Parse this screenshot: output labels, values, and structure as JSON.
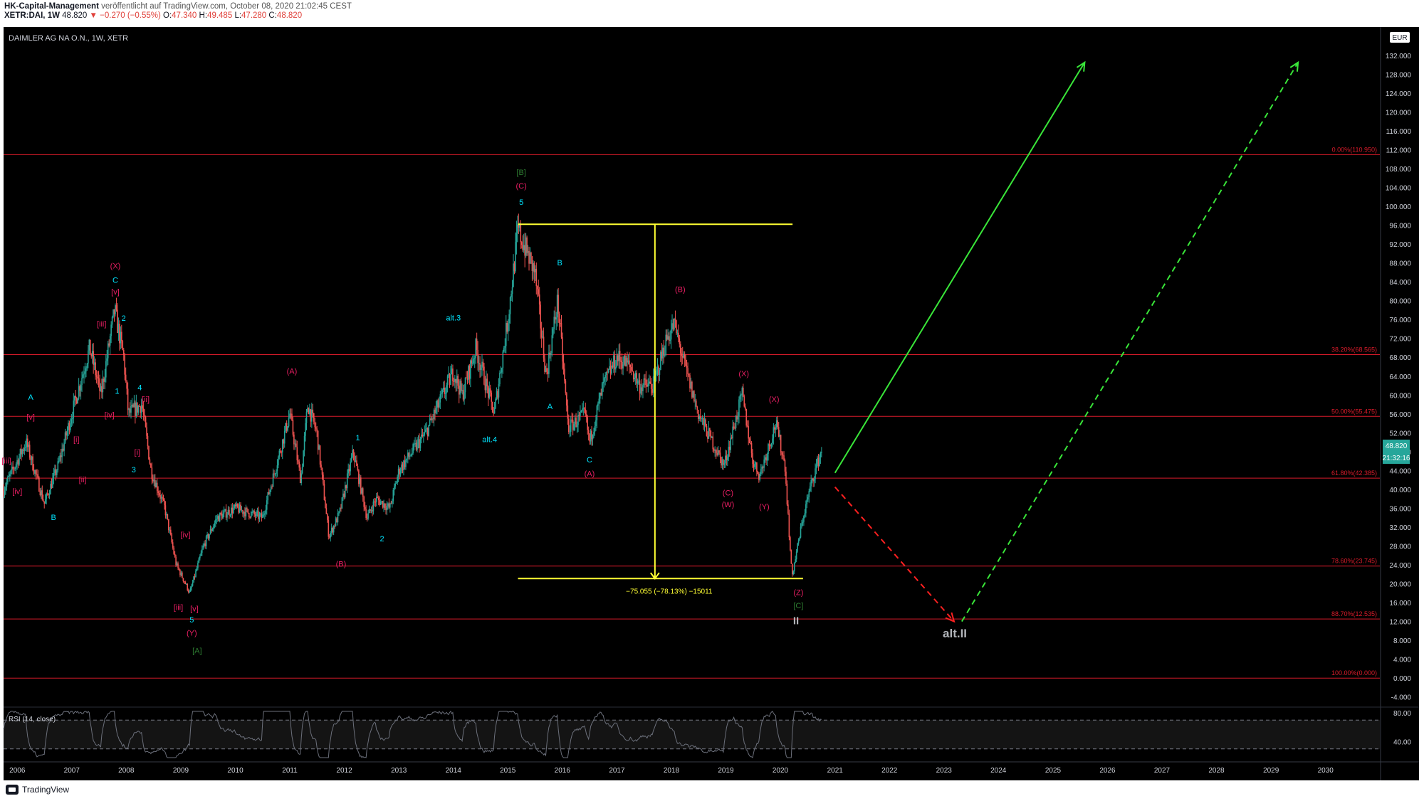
{
  "header": {
    "publisher": "HK-Capital-Management",
    "published_text": "veröffentlicht auf TradingView.com, October 08, 2020 21:02:45 CEST",
    "symbol_line": "XETR:DAI, 1W",
    "last": "48.820",
    "change": "−0.270 (−0.55%)",
    "o_label": "O:",
    "o": "47.340",
    "h_label": "H:",
    "h": "49.485",
    "l_label": "L:",
    "l": "47.280",
    "c_label": "C:",
    "c": "48.820"
  },
  "pane_title": "DAIMLER AG NA O.N., 1W, XETR",
  "currency": "EUR",
  "price_badge": {
    "price": "48.820",
    "countdown": "21:32:16"
  },
  "rsi_title": "RSI (14, close)",
  "footer": {
    "brand": "TradingView"
  },
  "colors": {
    "background": "#000000",
    "up": "#26a69a",
    "down": "#ef5350",
    "fib": "#d81b2a",
    "measure": "#ffff33",
    "bull_arrow": "#39e639",
    "bear_arrow": "#ff2020",
    "cyan": "#00e5ff",
    "magenta": "#e91e63",
    "green_label": "#2e7d32",
    "axis_text": "#d1d4dc"
  },
  "chart_data": {
    "type": "candlestick",
    "title": "DAIMLER AG NA O.N., 1W, XETR",
    "x_axis": {
      "type": "date",
      "range": [
        "2005-10-01",
        "2030-12-31"
      ],
      "ticks": [
        "2006",
        "2007",
        "2008",
        "2009",
        "2010",
        "2011",
        "2012",
        "2013",
        "2014",
        "2015",
        "2016",
        "2017",
        "2018",
        "2019",
        "2020",
        "2021",
        "2022",
        "2023",
        "2024",
        "2025",
        "2026",
        "2027",
        "2028",
        "2029",
        "2030"
      ]
    },
    "y_axis": {
      "range": [
        -6,
        138
      ],
      "ticks": [
        "132.000",
        "128.000",
        "124.000",
        "120.000",
        "116.000",
        "112.000",
        "108.000",
        "104.000",
        "100.000",
        "96.000",
        "92.000",
        "88.000",
        "84.000",
        "80.000",
        "76.000",
        "72.000",
        "68.000",
        "64.000",
        "60.000",
        "56.000",
        "52.000",
        "48.000",
        "44.000",
        "40.000",
        "36.000",
        "32.000",
        "28.000",
        "24.000",
        "20.000",
        "16.000",
        "12.000",
        "8.000",
        "4.000",
        "0.000",
        "-4.000"
      ]
    },
    "price_path": [
      [
        "2005-10-01",
        40
      ],
      [
        "2006-03-01",
        50
      ],
      [
        "2006-07-01",
        37
      ],
      [
        "2006-10-01",
        45
      ],
      [
        "2007-01-01",
        56
      ],
      [
        "2007-05-01",
        70
      ],
      [
        "2007-07-15",
        60
      ],
      [
        "2007-10-15",
        78
      ],
      [
        "2007-12-15",
        68
      ],
      [
        "2008-01-15",
        56
      ],
      [
        "2008-04-15",
        58
      ],
      [
        "2008-06-15",
        44
      ],
      [
        "2008-09-15",
        36
      ],
      [
        "2008-12-01",
        24
      ],
      [
        "2009-02-01",
        20
      ],
      [
        "2009-03-01",
        18
      ],
      [
        "2009-06-01",
        28
      ],
      [
        "2009-09-01",
        34
      ],
      [
        "2010-01-01",
        36
      ],
      [
        "2010-07-01",
        34
      ],
      [
        "2011-01-01",
        56
      ],
      [
        "2011-03-15",
        42
      ],
      [
        "2011-05-01",
        58
      ],
      [
        "2011-07-01",
        52
      ],
      [
        "2011-09-20",
        30
      ],
      [
        "2011-12-01",
        35
      ],
      [
        "2012-03-01",
        48
      ],
      [
        "2012-06-01",
        34
      ],
      [
        "2012-08-01",
        38
      ],
      [
        "2012-11-01",
        36
      ],
      [
        "2013-01-01",
        44
      ],
      [
        "2013-07-01",
        52
      ],
      [
        "2014-01-01",
        65
      ],
      [
        "2014-03-01",
        60
      ],
      [
        "2014-06-01",
        70
      ],
      [
        "2014-10-01",
        56
      ],
      [
        "2015-01-01",
        76
      ],
      [
        "2015-03-10",
        95
      ],
      [
        "2015-07-01",
        86
      ],
      [
        "2015-09-15",
        64
      ],
      [
        "2015-12-01",
        80
      ],
      [
        "2016-02-10",
        53
      ],
      [
        "2016-06-01",
        56
      ],
      [
        "2016-07-01",
        50
      ],
      [
        "2016-10-01",
        62
      ],
      [
        "2017-01-01",
        68
      ],
      [
        "2017-04-01",
        66
      ],
      [
        "2017-06-01",
        62
      ],
      [
        "2017-09-01",
        62
      ],
      [
        "2017-12-01",
        72
      ],
      [
        "2018-01-20",
        75
      ],
      [
        "2018-04-01",
        66
      ],
      [
        "2018-07-01",
        56
      ],
      [
        "2018-12-20",
        45
      ],
      [
        "2019-03-01",
        54
      ],
      [
        "2019-04-20",
        60
      ],
      [
        "2019-07-01",
        46
      ],
      [
        "2019-08-15",
        43
      ],
      [
        "2019-12-01",
        54
      ],
      [
        "2020-02-01",
        45
      ],
      [
        "2020-03-18",
        21.5
      ],
      [
        "2020-06-01",
        34
      ],
      [
        "2020-08-01",
        42
      ],
      [
        "2020-10-08",
        48.82
      ]
    ],
    "fibonacci": [
      {
        "label": "0.00%(110.950)",
        "value": 110.95
      },
      {
        "label": "38.20%(68.565)",
        "value": 68.565
      },
      {
        "label": "50.00%(55.475)",
        "value": 55.475
      },
      {
        "label": "61.80%(42.385)",
        "value": 42.385
      },
      {
        "label": "78.60%(23.745)",
        "value": 23.745
      },
      {
        "label": "88.70%(12.535)",
        "value": 12.535
      },
      {
        "label": "100.00%(0.000)",
        "value": 0.0
      }
    ],
    "measure": {
      "top": 96.2,
      "bottom": 21.1,
      "from_date": "2015-03-10",
      "to_date": "2020-03-18",
      "label": "−75.055 (−78.13%) −15011"
    },
    "projections": [
      {
        "name": "bull",
        "style": "solid",
        "color": "#39e639",
        "from": [
          "2021-01-01",
          43.5
        ],
        "to": [
          "2025-08-01",
          130.5
        ]
      },
      {
        "name": "bear",
        "style": "dashed",
        "color": "#ff2020",
        "from": [
          "2021-01-01",
          40.5
        ],
        "to": [
          "2023-03-10",
          12.0
        ]
      },
      {
        "name": "alt bull",
        "style": "dashed",
        "color": "#39e639",
        "from": [
          "2023-05-01",
          12.0
        ],
        "to": [
          "2029-07-01",
          130.5
        ]
      }
    ],
    "wave_labels": [
      {
        "text": "[iii]",
        "date": "2005-10-20",
        "value": 45.5,
        "color": "magenta"
      },
      {
        "text": "[iv]",
        "date": "2006-01-01",
        "value": 39,
        "color": "magenta"
      },
      {
        "text": "A",
        "date": "2006-04-01",
        "value": 59,
        "color": "cyan"
      },
      {
        "text": "[v]",
        "date": "2006-04-01",
        "value": 54.8,
        "color": "magenta"
      },
      {
        "text": "B",
        "date": "2006-09-01",
        "value": 33.5,
        "color": "cyan"
      },
      {
        "text": "[i]",
        "date": "2007-02-01",
        "value": 50,
        "color": "magenta"
      },
      {
        "text": "[ii]",
        "date": "2007-03-15",
        "value": 41.5,
        "color": "magenta"
      },
      {
        "text": "[iii]",
        "date": "2007-07-20",
        "value": 74.5,
        "color": "magenta"
      },
      {
        "text": "[iv]",
        "date": "2007-09-10",
        "value": 55.2,
        "color": "magenta"
      },
      {
        "text": "2",
        "date": "2007-12-15",
        "value": 75.7,
        "color": "cyan"
      },
      {
        "text": "[v]",
        "date": "2007-10-20",
        "value": 81.3,
        "color": "magenta"
      },
      {
        "text": "C",
        "date": "2007-10-20",
        "value": 83.8,
        "color": "cyan"
      },
      {
        "text": "(X)",
        "date": "2007-10-20",
        "value": 86.8,
        "color": "magenta"
      },
      {
        "text": "1",
        "date": "2007-11-01",
        "value": 60.3,
        "color": "cyan"
      },
      {
        "text": "4",
        "date": "2008-04-01",
        "value": 61.0,
        "color": "cyan"
      },
      {
        "text": "[ii]",
        "date": "2008-05-10",
        "value": 58.5,
        "color": "magenta"
      },
      {
        "text": "[i]",
        "date": "2008-03-15",
        "value": 47.3,
        "color": "magenta"
      },
      {
        "text": "3",
        "date": "2008-02-20",
        "value": 43.6,
        "color": "cyan"
      },
      {
        "text": "[iv]",
        "date": "2009-02-01",
        "value": 29.8,
        "color": "magenta"
      },
      {
        "text": "[iii]",
        "date": "2008-12-15",
        "value": 14.4,
        "color": "magenta"
      },
      {
        "text": "[v]",
        "date": "2009-04-01",
        "value": 14.1,
        "color": "magenta"
      },
      {
        "text": "5",
        "date": "2009-03-15",
        "value": 11.8,
        "color": "cyan"
      },
      {
        "text": "(Y)",
        "date": "2009-03-15",
        "value": 9.0,
        "color": "magenta"
      },
      {
        "text": "[A]",
        "date": "2009-04-20",
        "value": 5.2,
        "color": "green"
      },
      {
        "text": "(A)",
        "date": "2011-01-15",
        "value": 64.5,
        "color": "magenta"
      },
      {
        "text": "(B)",
        "date": "2011-12-10",
        "value": 23.6,
        "color": "magenta"
      },
      {
        "text": "1",
        "date": "2012-04-01",
        "value": 50.4,
        "color": "cyan"
      },
      {
        "text": "2",
        "date": "2012-09-10",
        "value": 29.0,
        "color": "cyan"
      },
      {
        "text": "alt.3",
        "date": "2014-01-01",
        "value": 75.8,
        "color": "cyan"
      },
      {
        "text": "alt.4",
        "date": "2014-09-01",
        "value": 50.0,
        "color": "cyan"
      },
      {
        "text": "[B]",
        "date": "2015-04-01",
        "value": 106.6,
        "color": "green"
      },
      {
        "text": "(C)",
        "date": "2015-04-01",
        "value": 103.8,
        "color": "magenta"
      },
      {
        "text": "5",
        "date": "2015-04-01",
        "value": 100.3,
        "color": "cyan"
      },
      {
        "text": "B",
        "date": "2015-12-15",
        "value": 87.5,
        "color": "cyan"
      },
      {
        "text": "A",
        "date": "2015-10-10",
        "value": 57.0,
        "color": "cyan"
      },
      {
        "text": "C",
        "date": "2016-07-01",
        "value": 45.7,
        "color": "cyan"
      },
      {
        "text": "(A)",
        "date": "2016-07-01",
        "value": 42.8,
        "color": "magenta"
      },
      {
        "text": "(B)",
        "date": "2018-03-01",
        "value": 81.8,
        "color": "magenta"
      },
      {
        "text": "(X)",
        "date": "2019-05-01",
        "value": 64.0,
        "color": "magenta"
      },
      {
        "text": "(C)",
        "date": "2019-01-15",
        "value": 38.7,
        "color": "magenta"
      },
      {
        "text": "(W)",
        "date": "2019-01-15",
        "value": 36.2,
        "color": "magenta"
      },
      {
        "text": "(X)",
        "date": "2019-11-20",
        "value": 58.5,
        "color": "magenta"
      },
      {
        "text": "(Y)",
        "date": "2019-09-15",
        "value": 35.8,
        "color": "magenta"
      },
      {
        "text": "(Z)",
        "date": "2020-05-01",
        "value": 17.6,
        "color": "magenta"
      },
      {
        "text": "[C]",
        "date": "2020-05-01",
        "value": 14.8,
        "color": "green"
      },
      {
        "text": "II",
        "date": "2020-04-15",
        "value": 11.4,
        "color": "grey"
      },
      {
        "text": "alt.II",
        "date": "2023-03-15",
        "value": 8.6,
        "color": "grey"
      }
    ],
    "rsi": {
      "title": "RSI (14, close)",
      "levels": [
        70,
        30
      ],
      "ticks": [
        "80.00",
        "40.00"
      ]
    }
  }
}
